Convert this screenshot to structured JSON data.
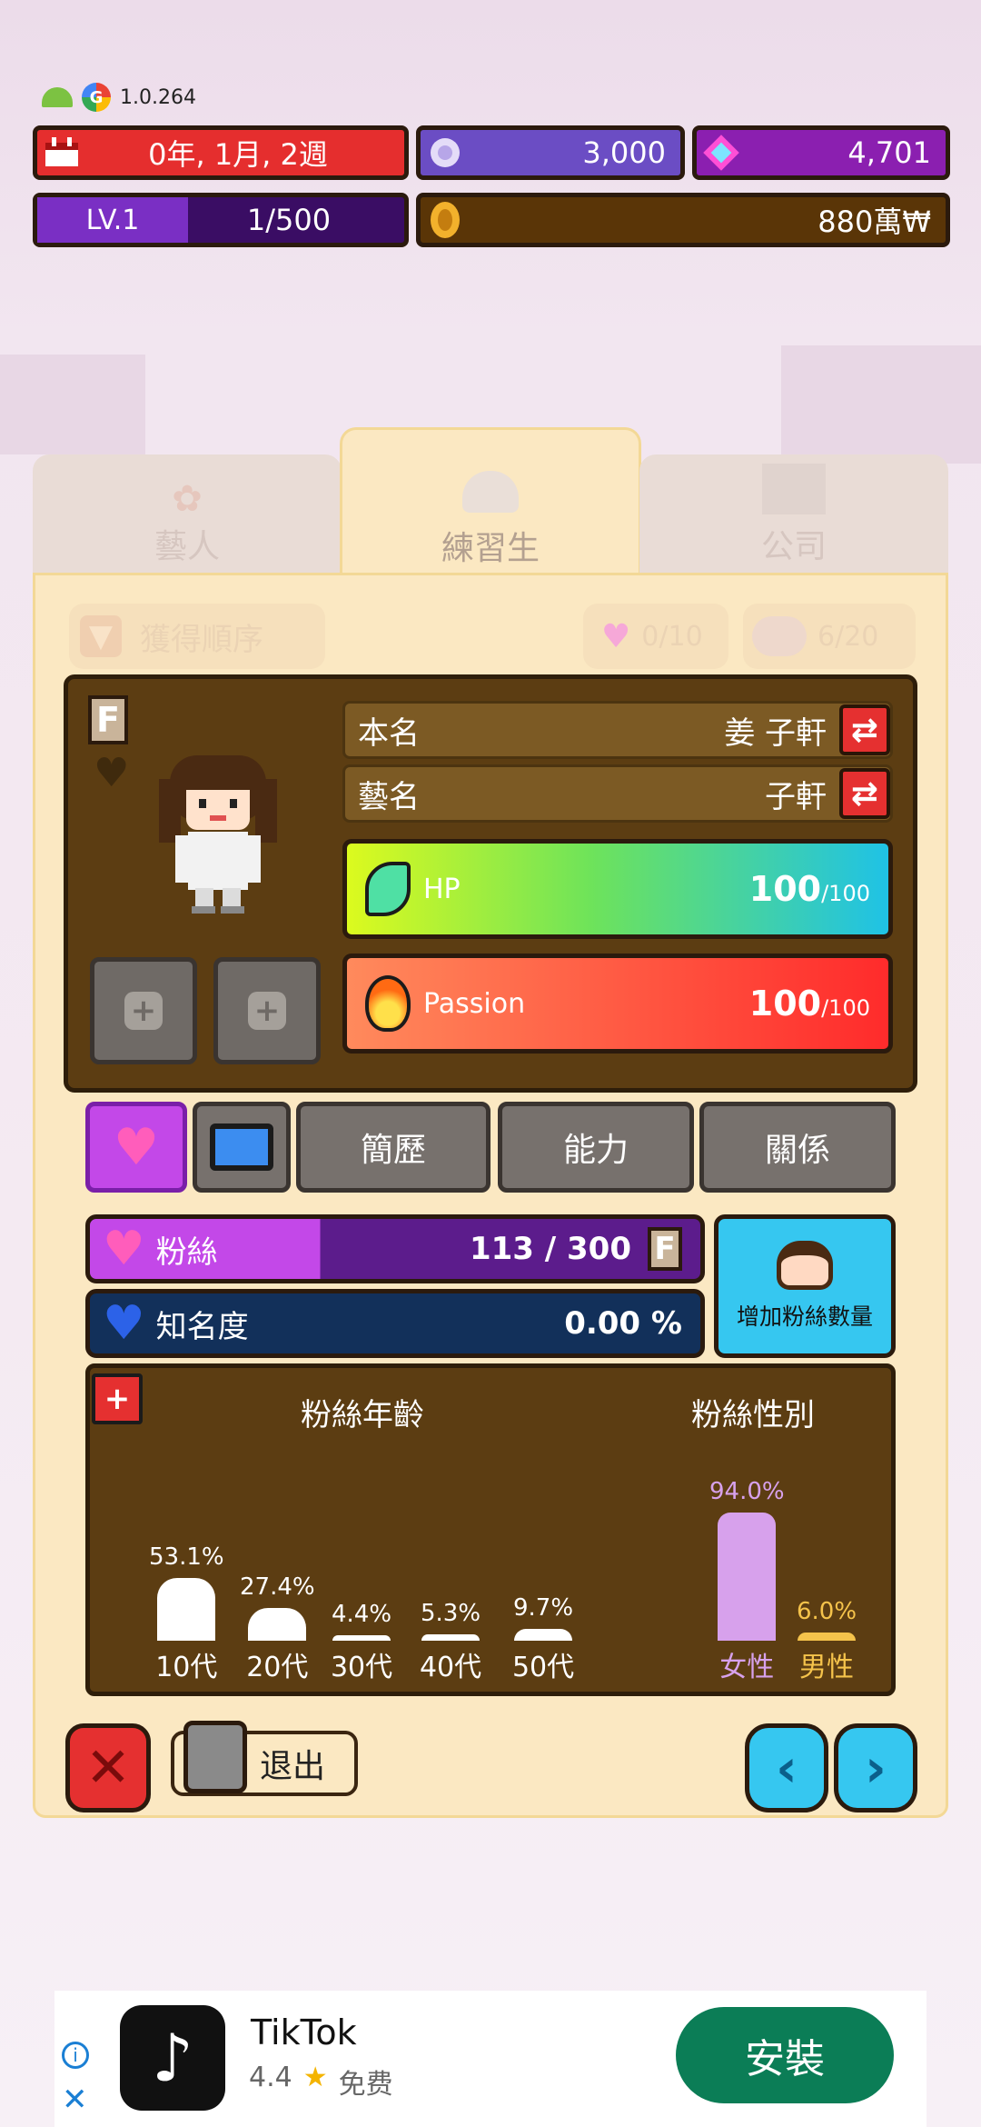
{
  "status": {
    "version": "1.0.264"
  },
  "top": {
    "date": "0年, 1月, 2週",
    "currency1": "3,000",
    "currency2": "4,701",
    "level": "LV.1",
    "exp": "1/500",
    "money": "880萬₩"
  },
  "tabs": {
    "artist": "藝人",
    "trainee": "練習生",
    "company": "公司"
  },
  "filter": {
    "sort_label": "獲得順序",
    "hearts": "0/10",
    "trainees": "6/20"
  },
  "profile": {
    "grade": "F",
    "real_name_label": "本名",
    "real_name": "姜 子軒",
    "stage_name_label": "藝名",
    "stage_name": "子軒",
    "hp_label": "HP",
    "hp_value": "100",
    "hp_max": "/100",
    "passion_label": "Passion",
    "passion_value": "100",
    "passion_max": "/100"
  },
  "subtabs": {
    "resume": "簡歷",
    "ability": "能力",
    "relation": "關係"
  },
  "fans": {
    "fans_label": "粉絲",
    "fans_value": "113 / 300",
    "fans_grade": "F",
    "fame_label": "知名度",
    "fame_value": "0.00 %",
    "add_fans": "增加粉絲數量"
  },
  "chart_data": [
    {
      "type": "bar",
      "title": "粉絲年齡",
      "categories": [
        "10代",
        "20代",
        "30代",
        "40代",
        "50代"
      ],
      "values": [
        53.1,
        27.4,
        4.4,
        5.3,
        9.7
      ],
      "labels": [
        "53.1%",
        "27.4%",
        "4.4%",
        "5.3%",
        "9.7%"
      ]
    },
    {
      "type": "bar",
      "title": "粉絲性別",
      "categories": [
        "女性",
        "男性"
      ],
      "values": [
        94.0,
        6.0
      ],
      "labels": [
        "94.0%",
        "6.0%"
      ],
      "colors": [
        "#d7a1ec",
        "#f5c34b"
      ]
    }
  ],
  "bottom": {
    "exit_label": "退出"
  },
  "ad": {
    "app_name": "TikTok",
    "rating": "4.4",
    "price": "免费",
    "install": "安裝"
  },
  "colors": {
    "purple": "#a52fe0",
    "navy": "#12305a",
    "brown": "#5c3d12",
    "red": "#e53030",
    "cyan": "#36c7f0"
  }
}
